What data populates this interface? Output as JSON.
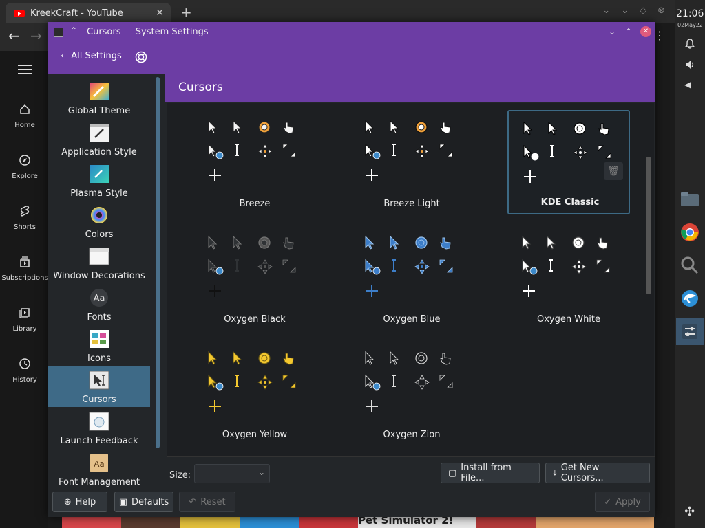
{
  "browser": {
    "tab_title": "KreekCraft - YouTube",
    "tab_close": "✕",
    "new_tab": "+",
    "back": "←",
    "forward": "→",
    "menu": "⋮"
  },
  "youtube": {
    "menu_icon": "hamburger-icon",
    "items": [
      {
        "label": "Home",
        "icon": "home-icon"
      },
      {
        "label": "Explore",
        "icon": "compass-icon"
      },
      {
        "label": "Shorts",
        "icon": "shorts-icon"
      },
      {
        "label": "Subscriptions",
        "icon": "subscriptions-icon"
      },
      {
        "label": "Library",
        "icon": "library-icon"
      },
      {
        "label": "History",
        "icon": "history-icon"
      }
    ],
    "thumb_text": "Pet Simulator 2!"
  },
  "taskbar": {
    "time": "21:06",
    "date": "02May22",
    "apps": [
      "folder-icon",
      "chrome-icon",
      "search-icon",
      "edge-icon",
      "settings-icon"
    ],
    "active_app": 4
  },
  "window": {
    "title": "Cursors — System Settings",
    "back_label": "All Settings",
    "page_title": "Cursors",
    "accent": "#6c3da4",
    "selection": "#3e6a87"
  },
  "categories": [
    {
      "label": "Global Theme",
      "color": "#d64e9a"
    },
    {
      "label": "Application Style",
      "color": "#ffffff"
    },
    {
      "label": "Plasma Style",
      "color": "#3aa8c6"
    },
    {
      "label": "Colors",
      "color": "#ffffff"
    },
    {
      "label": "Window Decorations",
      "color": "#ffffff"
    },
    {
      "label": "Fonts",
      "color": "#3a3d41"
    },
    {
      "label": "Icons",
      "color": "#ffffff"
    },
    {
      "label": "Cursors",
      "color": "#e5e5e5"
    },
    {
      "label": "Launch Feedback",
      "color": "#ffffff"
    },
    {
      "label": "Font Management",
      "color": "#e4c08a"
    }
  ],
  "selected_category": 7,
  "themes": [
    {
      "name": "Breeze",
      "style": "breeze"
    },
    {
      "name": "Breeze Light",
      "style": "breeze-light"
    },
    {
      "name": "KDE Classic",
      "style": "classic",
      "selected": true
    },
    {
      "name": "Oxygen Black",
      "style": "ox-black"
    },
    {
      "name": "Oxygen Blue",
      "style": "ox-blue"
    },
    {
      "name": "Oxygen White",
      "style": "ox-white"
    },
    {
      "name": "Oxygen Yellow",
      "style": "ox-yellow"
    },
    {
      "name": "Oxygen Zion",
      "style": "ox-zion"
    }
  ],
  "bottom": {
    "size_label": "Size:",
    "size_value": "",
    "install_label": "Install from File...",
    "get_new_label": "Get New Cursors..."
  },
  "footer": {
    "help": "Help",
    "defaults": "Defaults",
    "reset": "Reset",
    "apply": "Apply"
  }
}
